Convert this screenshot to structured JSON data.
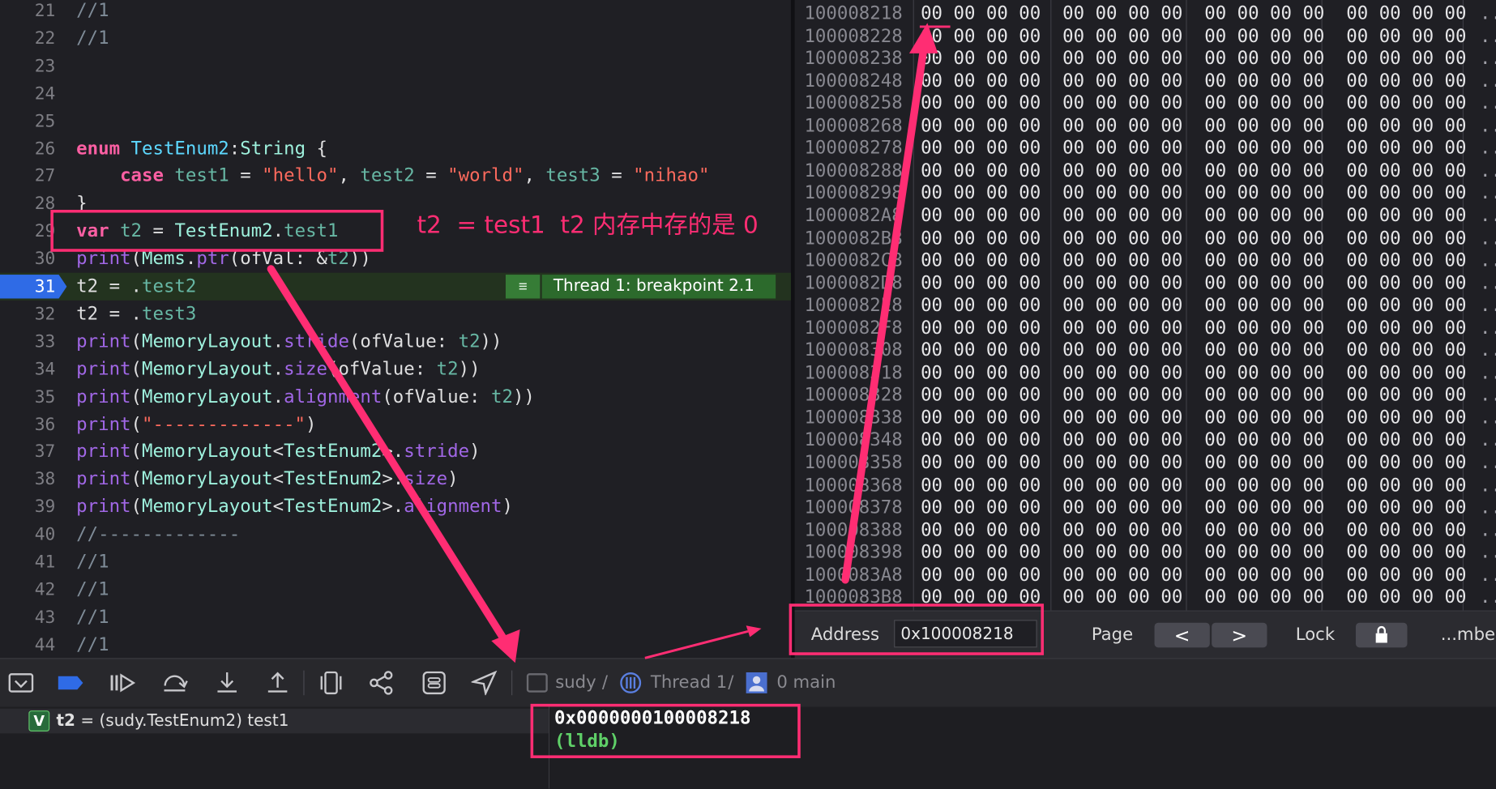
{
  "editor": {
    "lines": [
      {
        "n": "21",
        "t": "//1"
      },
      {
        "n": "22",
        "t": "//1"
      },
      {
        "n": "23",
        "t": ""
      },
      {
        "n": "24",
        "t": ""
      },
      {
        "n": "25",
        "t": ""
      },
      {
        "n": "26",
        "t": "enum TestEnum2:String {"
      },
      {
        "n": "27",
        "t": "    case test1 = \"hello\", test2 = \"world\", test3 = \"nihao\""
      },
      {
        "n": "28",
        "t": "}"
      },
      {
        "n": "29",
        "t": "var t2 = TestEnum2.test1"
      },
      {
        "n": "30",
        "t": "print(Mems.ptr(ofVal: &t2))"
      },
      {
        "n": "31",
        "t": "t2 = .test2"
      },
      {
        "n": "32",
        "t": "t2 = .test3"
      },
      {
        "n": "33",
        "t": "print(MemoryLayout.stride(ofValue: t2))"
      },
      {
        "n": "34",
        "t": "print(MemoryLayout.size(ofValue: t2))"
      },
      {
        "n": "35",
        "t": "print(MemoryLayout.alignment(ofValue: t2))"
      },
      {
        "n": "36",
        "t": "print(\"-------------\")"
      },
      {
        "n": "37",
        "t": "print(MemoryLayout<TestEnum2>.stride)"
      },
      {
        "n": "38",
        "t": "print(MemoryLayout<TestEnum2>.size)"
      },
      {
        "n": "39",
        "t": "print(MemoryLayout<TestEnum2>.alignment)"
      },
      {
        "n": "40",
        "t": "//-------------"
      },
      {
        "n": "41",
        "t": "//1"
      },
      {
        "n": "42",
        "t": "//1"
      },
      {
        "n": "43",
        "t": "//1"
      },
      {
        "n": "44",
        "t": "//1"
      }
    ],
    "current_line": "31",
    "breakpoint_label": "Thread 1: breakpoint 2.1"
  },
  "annotation": {
    "text": "t2  = test1  t2 内存中存的是 0"
  },
  "memory": {
    "rows": [
      {
        "addr": "100008218",
        "bytes": "00 00 00 00  00 00 00 00  00 00 00 00  00 00 00 00",
        "ascii": ".."
      },
      {
        "addr": "100008228",
        "bytes": "00 00 00 00  00 00 00 00  00 00 00 00  00 00 00 00",
        "ascii": ".."
      },
      {
        "addr": "100008238",
        "bytes": "00 00 00 00  00 00 00 00  00 00 00 00  00 00 00 00",
        "ascii": ".."
      },
      {
        "addr": "100008248",
        "bytes": "00 00 00 00  00 00 00 00  00 00 00 00  00 00 00 00",
        "ascii": ".."
      },
      {
        "addr": "100008258",
        "bytes": "00 00 00 00  00 00 00 00  00 00 00 00  00 00 00 00",
        "ascii": ".."
      },
      {
        "addr": "100008268",
        "bytes": "00 00 00 00  00 00 00 00  00 00 00 00  00 00 00 00",
        "ascii": ".."
      },
      {
        "addr": "100008278",
        "bytes": "00 00 00 00  00 00 00 00  00 00 00 00  00 00 00 00",
        "ascii": ".."
      },
      {
        "addr": "100008288",
        "bytes": "00 00 00 00  00 00 00 00  00 00 00 00  00 00 00 00",
        "ascii": ".."
      },
      {
        "addr": "100008298",
        "bytes": "00 00 00 00  00 00 00 00  00 00 00 00  00 00 00 00",
        "ascii": ".."
      },
      {
        "addr": "1000082A8",
        "bytes": "00 00 00 00  00 00 00 00  00 00 00 00  00 00 00 00",
        "ascii": ".."
      },
      {
        "addr": "1000082B8",
        "bytes": "00 00 00 00  00 00 00 00  00 00 00 00  00 00 00 00",
        "ascii": ".."
      },
      {
        "addr": "1000082C8",
        "bytes": "00 00 00 00  00 00 00 00  00 00 00 00  00 00 00 00",
        "ascii": ".."
      },
      {
        "addr": "1000082D8",
        "bytes": "00 00 00 00  00 00 00 00  00 00 00 00  00 00 00 00",
        "ascii": ".."
      },
      {
        "addr": "1000082E8",
        "bytes": "00 00 00 00  00 00 00 00  00 00 00 00  00 00 00 00",
        "ascii": ".."
      },
      {
        "addr": "1000082F8",
        "bytes": "00 00 00 00  00 00 00 00  00 00 00 00  00 00 00 00",
        "ascii": ".."
      },
      {
        "addr": "100008308",
        "bytes": "00 00 00 00  00 00 00 00  00 00 00 00  00 00 00 00",
        "ascii": ".."
      },
      {
        "addr": "100008318",
        "bytes": "00 00 00 00  00 00 00 00  00 00 00 00  00 00 00 00",
        "ascii": ".."
      },
      {
        "addr": "100008328",
        "bytes": "00 00 00 00  00 00 00 00  00 00 00 00  00 00 00 00",
        "ascii": ".."
      },
      {
        "addr": "100008338",
        "bytes": "00 00 00 00  00 00 00 00  00 00 00 00  00 00 00 00",
        "ascii": ".."
      },
      {
        "addr": "100008348",
        "bytes": "00 00 00 00  00 00 00 00  00 00 00 00  00 00 00 00",
        "ascii": ".."
      },
      {
        "addr": "100008358",
        "bytes": "00 00 00 00  00 00 00 00  00 00 00 00  00 00 00 00",
        "ascii": ".."
      },
      {
        "addr": "100008368",
        "bytes": "00 00 00 00  00 00 00 00  00 00 00 00  00 00 00 00",
        "ascii": ".."
      },
      {
        "addr": "100008378",
        "bytes": "00 00 00 00  00 00 00 00  00 00 00 00  00 00 00 00",
        "ascii": ".."
      },
      {
        "addr": "100008388",
        "bytes": "00 00 00 00  00 00 00 00  00 00 00 00  00 00 00 00",
        "ascii": ".."
      },
      {
        "addr": "100008398",
        "bytes": "00 00 00 00  00 00 00 00  00 00 00 00  00 00 00 00",
        "ascii": ".."
      },
      {
        "addr": "1000083A8",
        "bytes": "00 00 00 00  00 00 00 00  00 00 00 00  00 00 00 00",
        "ascii": ".."
      },
      {
        "addr": "1000083B8",
        "bytes": "00 00 00 00  00 00 00 00  00 00 00 00  00 00 00 00",
        "ascii": ".."
      }
    ],
    "toolbar": {
      "address_label": "Address",
      "address_value": "0x100008218",
      "page_label": "Page",
      "prev_label": "<",
      "next_label": ">",
      "lock_label": "Lock",
      "number_label": "...mber"
    }
  },
  "debugbar": {
    "crumb_target": "sudy",
    "crumb_thread": "Thread 1",
    "crumb_frame": "0 main"
  },
  "variables": {
    "badge": "V",
    "name": "t2",
    "value": " = (sudy.TestEnum2) test1"
  },
  "console": {
    "output_line": "0x0000000100008218",
    "prompt": "(lldb)"
  },
  "colors": {
    "annotation": "#ff2d73",
    "breakpoint_marker": "#2f6be6",
    "breakpoint_badge": "#2c6a2c",
    "keyword": "#fc5fa3",
    "string": "#fc6a5d"
  }
}
